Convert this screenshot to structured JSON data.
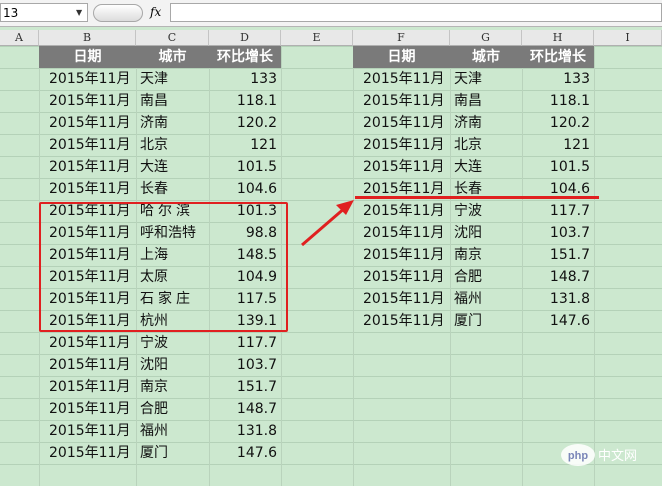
{
  "formula_bar": {
    "name_box": "13",
    "fx_label": "fx",
    "formula": ""
  },
  "columns": [
    "A",
    "B",
    "C",
    "D",
    "E",
    "F",
    "G",
    "H",
    "I"
  ],
  "left_table": {
    "headers": [
      "日期",
      "城市",
      "环比增长"
    ],
    "rows": [
      [
        "2015年11月",
        "天津",
        "133"
      ],
      [
        "2015年11月",
        "南昌",
        "118.1"
      ],
      [
        "2015年11月",
        "济南",
        "120.2"
      ],
      [
        "2015年11月",
        "北京",
        "121"
      ],
      [
        "2015年11月",
        "大连",
        "101.5"
      ],
      [
        "2015年11月",
        "长春",
        "104.6"
      ],
      [
        "2015年11月",
        "哈尔滨",
        "101.3"
      ],
      [
        "2015年11月",
        "呼和浩特",
        "98.8"
      ],
      [
        "2015年11月",
        "上海",
        "148.5"
      ],
      [
        "2015年11月",
        "太原",
        "104.9"
      ],
      [
        "2015年11月",
        "石家庄",
        "117.5"
      ],
      [
        "2015年11月",
        "杭州",
        "139.1"
      ],
      [
        "2015年11月",
        "宁波",
        "117.7"
      ],
      [
        "2015年11月",
        "沈阳",
        "103.7"
      ],
      [
        "2015年11月",
        "南京",
        "151.7"
      ],
      [
        "2015年11月",
        "合肥",
        "148.7"
      ],
      [
        "2015年11月",
        "福州",
        "131.8"
      ],
      [
        "2015年11月",
        "厦门",
        "147.6"
      ]
    ]
  },
  "right_table": {
    "headers": [
      "日期",
      "城市",
      "环比增长"
    ],
    "rows": [
      [
        "2015年11月",
        "天津",
        "133"
      ],
      [
        "2015年11月",
        "南昌",
        "118.1"
      ],
      [
        "2015年11月",
        "济南",
        "120.2"
      ],
      [
        "2015年11月",
        "北京",
        "121"
      ],
      [
        "2015年11月",
        "大连",
        "101.5"
      ],
      [
        "2015年11月",
        "长春",
        "104.6"
      ],
      [
        "2015年11月",
        "宁波",
        "117.7"
      ],
      [
        "2015年11月",
        "沈阳",
        "103.7"
      ],
      [
        "2015年11月",
        "南京",
        "151.7"
      ],
      [
        "2015年11月",
        "合肥",
        "148.7"
      ],
      [
        "2015年11月",
        "福州",
        "131.8"
      ],
      [
        "2015年11月",
        "厦门",
        "147.6"
      ]
    ]
  },
  "annotation_color": "#e02020",
  "watermark": {
    "logo": "php",
    "text": "中文网"
  }
}
